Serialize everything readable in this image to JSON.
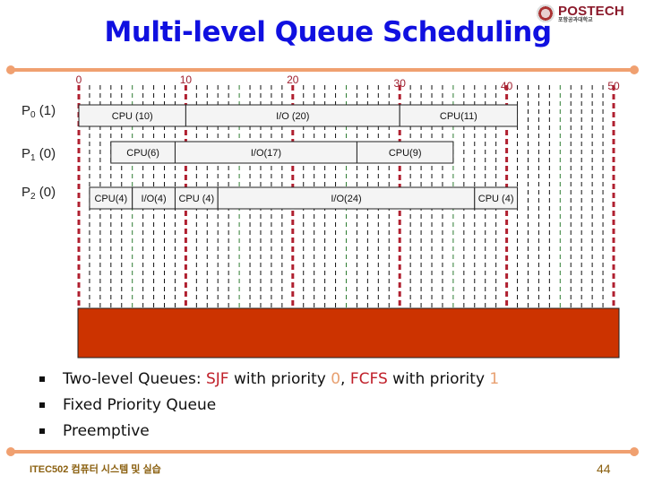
{
  "slide": {
    "title": "Multi-level Queue Scheduling",
    "logo": {
      "name": "POSTECH",
      "subtitle": "포항공과대학교",
      "icon": "university-emblem-icon"
    },
    "footer": {
      "course": "ITEC502 컴퓨터 시스템 및 실습",
      "page": "44"
    },
    "accent_colors": {
      "title": "#1010e0",
      "rule": "#f0a070",
      "highlight_red": "#c0202a",
      "highlight_orange": "#e8a070",
      "block": "#cc3300"
    }
  },
  "bullets": [
    {
      "parts": [
        {
          "text": "Two-level Queues: ",
          "style": "normal"
        },
        {
          "text": "SJF",
          "style": "red"
        },
        {
          "text": " with priority ",
          "style": "normal"
        },
        {
          "text": "0",
          "style": "orange"
        },
        {
          "text": ", ",
          "style": "normal"
        },
        {
          "text": "FCFS",
          "style": "red"
        },
        {
          "text": " with priority ",
          "style": "normal"
        },
        {
          "text": "1",
          "style": "orange"
        }
      ]
    },
    {
      "parts": [
        {
          "text": "Fixed Priority Queue",
          "style": "normal"
        }
      ]
    },
    {
      "parts": [
        {
          "text": "Preemptive",
          "style": "normal"
        }
      ]
    }
  ],
  "chart_data": {
    "type": "gantt",
    "title": "",
    "time_axis": {
      "min": 0,
      "max": 50,
      "major_ticks": [
        0,
        10,
        20,
        30,
        40,
        50
      ],
      "minor_step": 1,
      "mid_step": 5
    },
    "grid": true,
    "rows": [
      {
        "process": "P",
        "index": "0",
        "priority": "(1)",
        "segments": [
          {
            "label": "CPU (10)",
            "kind": "CPU",
            "start": 0,
            "end": 10
          },
          {
            "label": "I/O (20)",
            "kind": "I/O",
            "start": 10,
            "end": 30
          },
          {
            "label": "CPU(11)",
            "kind": "CPU",
            "start": 30,
            "end": 41
          }
        ]
      },
      {
        "process": "P",
        "index": "1",
        "priority": "(0)",
        "segments": [
          {
            "label": "CPU(6)",
            "kind": "CPU",
            "start": 3,
            "end": 9
          },
          {
            "label": "I/O(17)",
            "kind": "I/O",
            "start": 9,
            "end": 26
          },
          {
            "label": "CPU(9)",
            "kind": "CPU",
            "start": 26,
            "end": 35
          }
        ]
      },
      {
        "process": "P",
        "index": "2",
        "priority": "(0)",
        "segments": [
          {
            "label": "CPU(4)",
            "kind": "CPU",
            "start": 1,
            "end": 5
          },
          {
            "label": "I/O(4)",
            "kind": "I/O",
            "start": 5,
            "end": 9
          },
          {
            "label": "CPU (4)",
            "kind": "CPU",
            "start": 9,
            "end": 13
          },
          {
            "label": "I/O(24)",
            "kind": "I/O",
            "start": 13,
            "end": 37
          },
          {
            "label": "CPU (4)",
            "kind": "CPU",
            "start": 37,
            "end": 41
          }
        ]
      }
    ],
    "execution_timeline": {
      "range": [
        0,
        50
      ],
      "segments": []
    }
  }
}
